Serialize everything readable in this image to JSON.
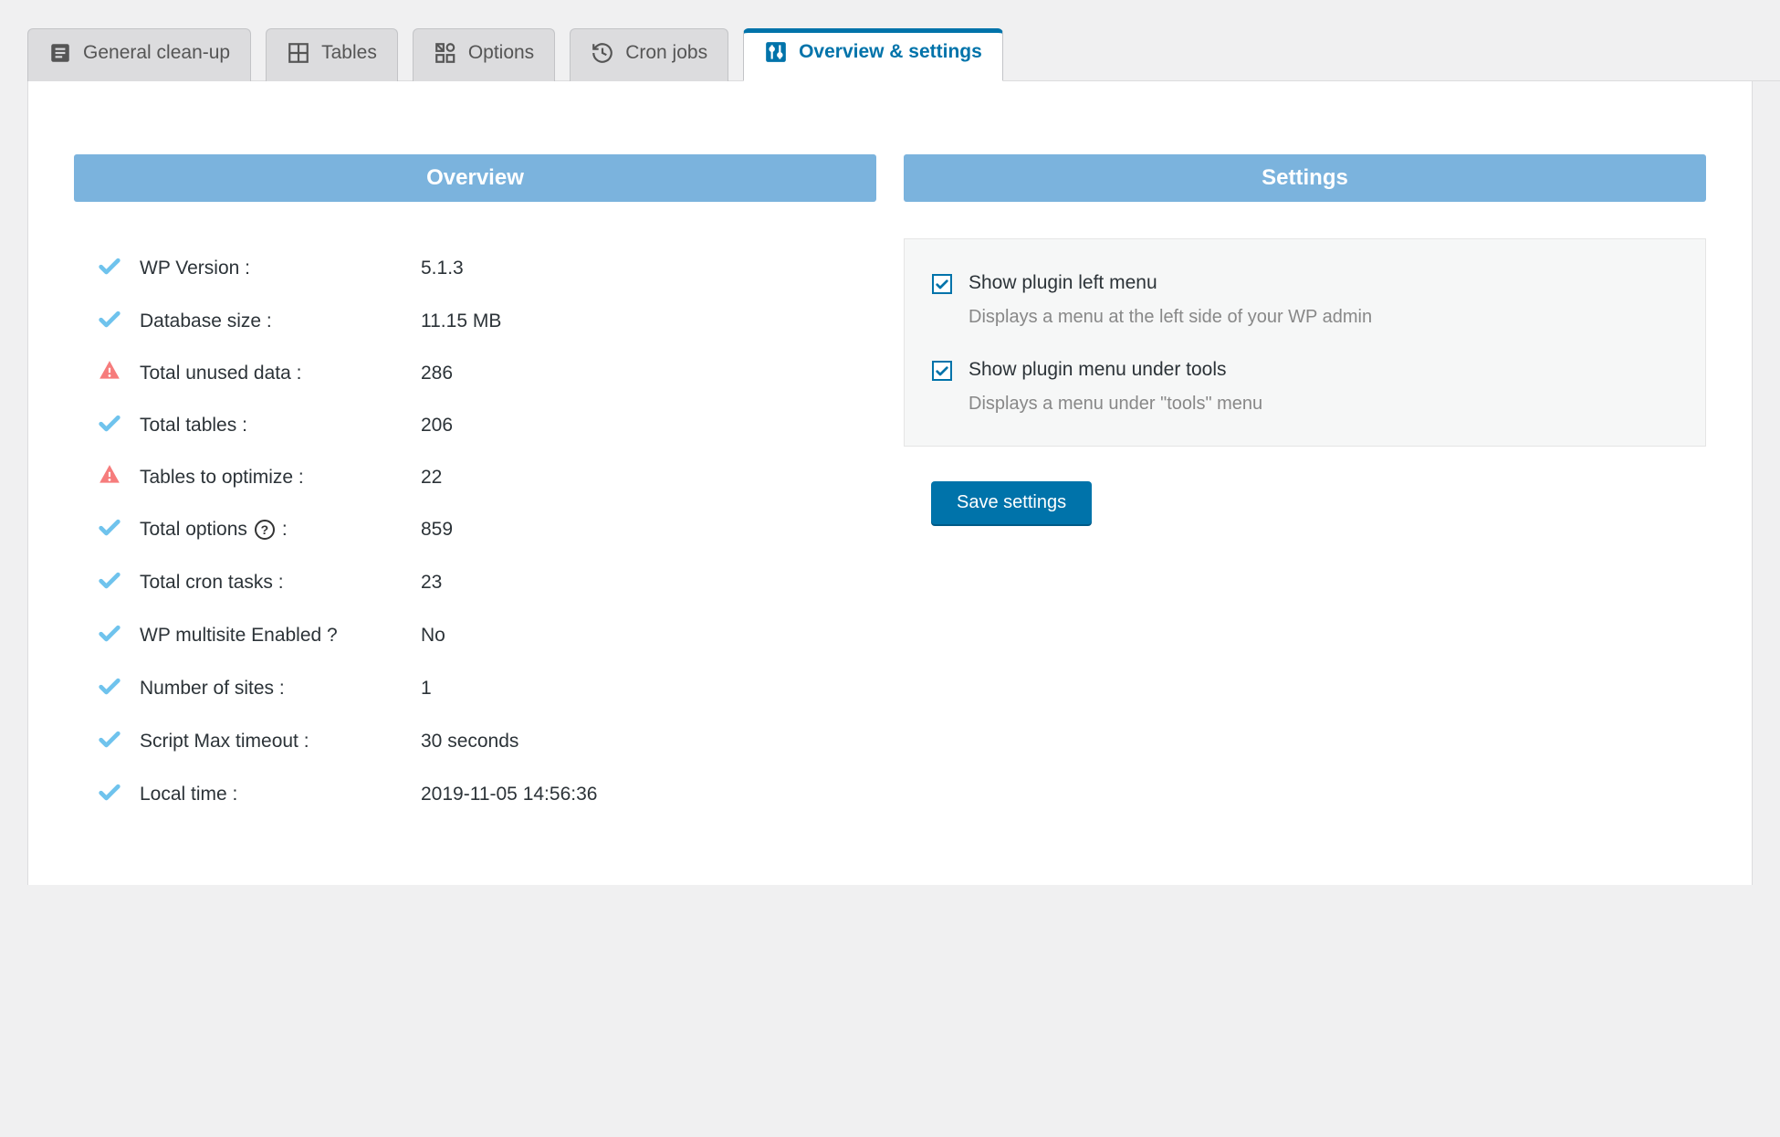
{
  "tabs": [
    {
      "label": "General clean-up"
    },
    {
      "label": "Tables"
    },
    {
      "label": "Options"
    },
    {
      "label": "Cron jobs"
    },
    {
      "label": "Overview & settings"
    }
  ],
  "active_tab": 4,
  "overview": {
    "title": "Overview",
    "rows": [
      {
        "status": "ok",
        "label": "WP Version :",
        "value": "5.1.3"
      },
      {
        "status": "ok",
        "label": "Database size :",
        "value": "11.15 MB"
      },
      {
        "status": "warn",
        "label": "Total unused data :",
        "value": "286"
      },
      {
        "status": "ok",
        "label": "Total tables :",
        "value": "206"
      },
      {
        "status": "warn",
        "label": "Tables to optimize :",
        "value": "22"
      },
      {
        "status": "ok",
        "label": "Total options",
        "help": true,
        "suffix": " :",
        "value": "859"
      },
      {
        "status": "ok",
        "label": "Total cron tasks :",
        "value": "23"
      },
      {
        "status": "ok",
        "label": "WP multisite Enabled ?",
        "value": "No"
      },
      {
        "status": "ok",
        "label": "Number of sites :",
        "value": "1"
      },
      {
        "status": "ok",
        "label": "Script Max timeout :",
        "value": "30 seconds"
      },
      {
        "status": "ok",
        "label": "Local time :",
        "value": "2019-11-05 14:56:36"
      }
    ]
  },
  "settings": {
    "title": "Settings",
    "items": [
      {
        "checked": true,
        "title": "Show plugin left menu",
        "desc": "Displays a menu at the left side of your WP admin"
      },
      {
        "checked": true,
        "title": "Show plugin menu under tools",
        "desc": "Displays a menu under \"tools\" menu"
      }
    ],
    "save_label": "Save settings"
  }
}
